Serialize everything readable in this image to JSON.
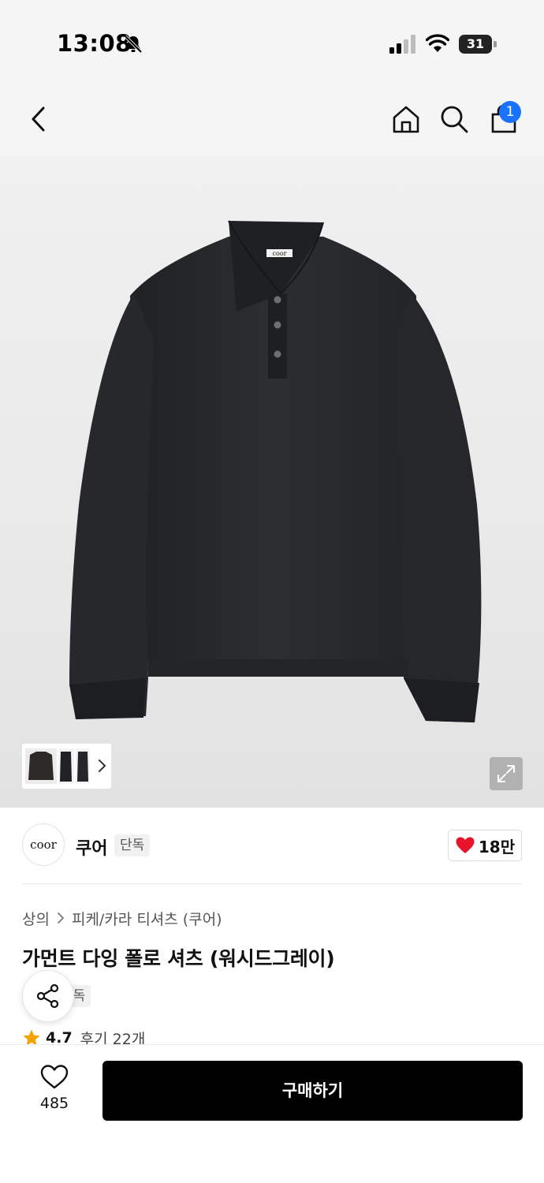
{
  "status_bar": {
    "time": "13:08",
    "battery": "31",
    "icons": [
      "bell-off-icon",
      "signal-icon",
      "wifi-icon",
      "battery-icon"
    ]
  },
  "header": {
    "icons": [
      "chevron-left-icon",
      "home-icon",
      "search-icon",
      "shopping-bag-icon"
    ],
    "cart_badge": "1",
    "accent_color": "#1a73ff"
  },
  "product_image": {
    "garment_label_text": "coor",
    "garment_color": "#2a2c2f"
  },
  "brand": {
    "logo_text": "coor",
    "name": "쿠어",
    "tag": "단독",
    "like_count": "18만",
    "heart_color": "#e8142c"
  },
  "breadcrumb": {
    "items": [
      "상의",
      "피케/카라 티셔츠 (쿠어)"
    ]
  },
  "product": {
    "title": "가먼트 다잉 폴로 셔츠 (워시드그레이)",
    "tag": "단독",
    "rating": "4.7",
    "reviews": "후기 22개",
    "star_color": "#f5a300"
  },
  "bottom_bar": {
    "wish_count": "485",
    "buy_label": "구매하기"
  }
}
